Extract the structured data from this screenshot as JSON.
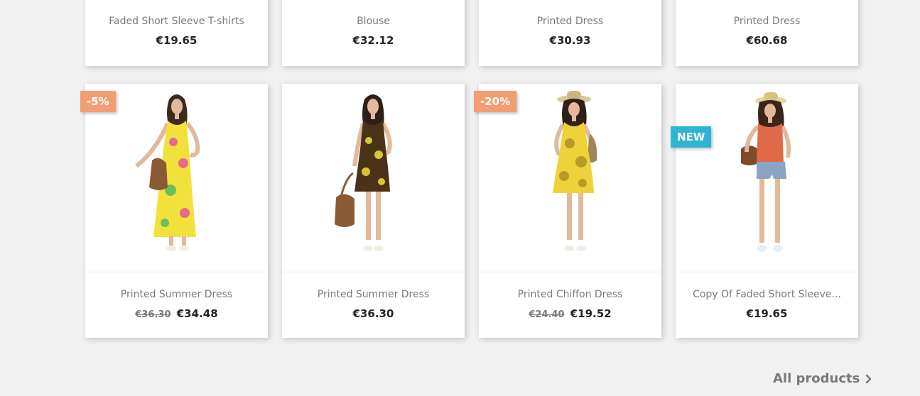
{
  "row1": [
    {
      "name": "Faded Short Sleeve T-shirts",
      "price": "€19.65"
    },
    {
      "name": "Blouse",
      "price": "€32.12"
    },
    {
      "name": "Printed Dress",
      "price": "€30.93"
    },
    {
      "name": "Printed Dress",
      "price": "€60.68"
    }
  ],
  "row2": [
    {
      "name": "Printed Summer Dress",
      "regular_price": "€36.30",
      "price": "€34.48",
      "badge": "-5%",
      "image": "woman-in-yellow-floral-maxi-dress"
    },
    {
      "name": "Printed Summer Dress",
      "price": "€36.30",
      "image": "woman-in-brown-yellow-short-dress"
    },
    {
      "name": "Printed Chiffon Dress",
      "regular_price": "€24.40",
      "price": "€19.52",
      "badge": "-20%",
      "image": "woman-in-yellow-chiffon-dress-with-hat"
    },
    {
      "name": "Copy Of Faded Short Sleeve...",
      "price": "€19.65",
      "badge": "NEW",
      "image": "woman-in-orange-top-and-denim-shorts"
    }
  ],
  "footer": {
    "all_products_label": "All products"
  },
  "colors": {
    "discount_badge": "#f39d72",
    "new_badge": "#2fb5d2",
    "page_bg": "#f1f1f1"
  },
  "icons": {
    "all_products": "chevron-right-icon"
  }
}
